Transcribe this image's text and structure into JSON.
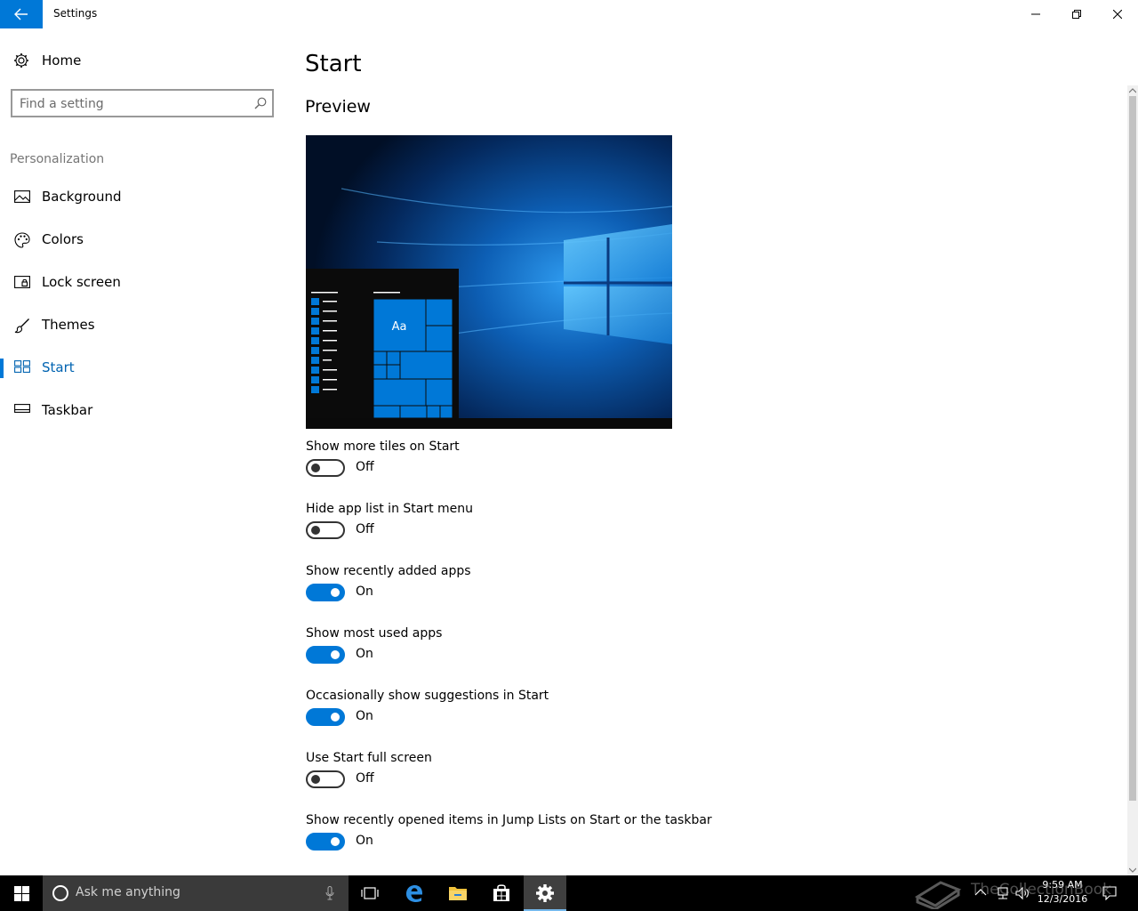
{
  "window": {
    "title": "Settings"
  },
  "sidebar": {
    "home_label": "Home",
    "search_placeholder": "Find a setting",
    "section_heading": "Personalization",
    "items": [
      {
        "label": "Background",
        "icon": "picture-icon"
      },
      {
        "label": "Colors",
        "icon": "palette-icon"
      },
      {
        "label": "Lock screen",
        "icon": "lock-screen-icon"
      },
      {
        "label": "Themes",
        "icon": "brush-icon"
      },
      {
        "label": "Start",
        "icon": "start-tiles-icon",
        "active": true
      },
      {
        "label": "Taskbar",
        "icon": "taskbar-icon"
      }
    ]
  },
  "main": {
    "title": "Start",
    "preview_heading": "Preview",
    "preview_tile_label": "Aa",
    "settings": [
      {
        "label": "Show more tiles on Start",
        "state": "Off",
        "on": false
      },
      {
        "label": "Hide app list in Start menu",
        "state": "Off",
        "on": false
      },
      {
        "label": "Show recently added apps",
        "state": "On",
        "on": true
      },
      {
        "label": "Show most used apps",
        "state": "On",
        "on": true
      },
      {
        "label": "Occasionally show suggestions in Start",
        "state": "On",
        "on": true
      },
      {
        "label": "Use Start full screen",
        "state": "Off",
        "on": false
      },
      {
        "label": "Show recently opened items in Jump Lists on Start or the taskbar",
        "state": "On",
        "on": true
      }
    ]
  },
  "taskbar": {
    "search_text": "Ask me anything",
    "time": "9:59 AM",
    "date": "12/3/2016"
  },
  "watermark": "TheCollectionBook",
  "colors": {
    "accent": "#0078d7",
    "accent_text": "#0063b1",
    "taskbar": "#000000",
    "toggle_off_border": "#333333"
  }
}
